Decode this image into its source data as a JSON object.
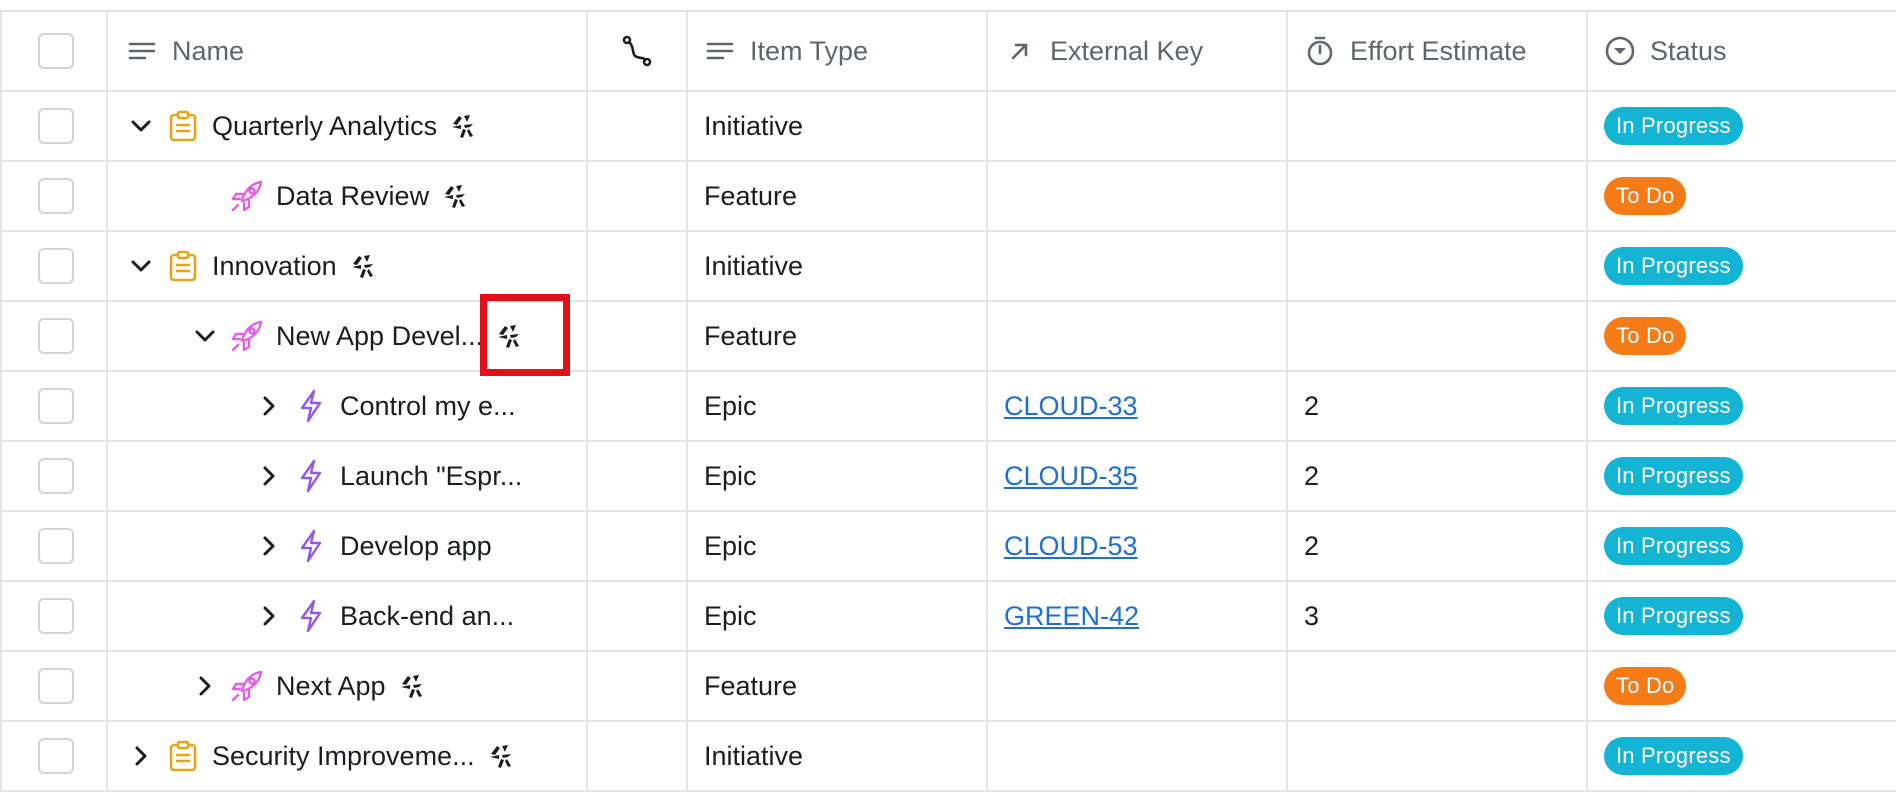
{
  "columns": {
    "name": "Name",
    "item_type": "Item Type",
    "external_key": "External Key",
    "effort": "Effort Estimate",
    "status": "Status"
  },
  "colors": {
    "in_progress": "#13b4d4",
    "to_do": "#f57b16",
    "initiative_icon": "#e8a317",
    "feature_icon": "#e45ee8",
    "epic_icon": "#9458e6",
    "link": "#1f6fd1",
    "highlight": "#e3101a"
  },
  "rows": [
    {
      "name": "Quarterly Analytics",
      "type": "Initiative",
      "key": "",
      "effort": "",
      "status": "In Progress",
      "icon": "clipboard-icon",
      "chevron": "chevron-down-icon"
    },
    {
      "name": "Data Review",
      "type": "Feature",
      "key": "",
      "effort": "",
      "status": "To Do",
      "icon": "rocket-icon",
      "chevron": ""
    },
    {
      "name": "Innovation",
      "type": "Initiative",
      "key": "",
      "effort": "",
      "status": "In Progress",
      "icon": "clipboard-icon",
      "chevron": "chevron-down-icon"
    },
    {
      "name": "New App Devel...",
      "type": "Feature",
      "key": "",
      "effort": "",
      "status": "To Do",
      "icon": "rocket-icon",
      "chevron": "chevron-down-icon"
    },
    {
      "name": "Control my e...",
      "type": "Epic",
      "key": "CLOUD-33",
      "effort": "2",
      "status": "In Progress",
      "icon": "lightning-icon",
      "chevron": "chevron-right-icon"
    },
    {
      "name": "Launch \"Espr...",
      "type": "Epic",
      "key": "CLOUD-35",
      "effort": "2",
      "status": "In Progress",
      "icon": "lightning-icon",
      "chevron": "chevron-right-icon"
    },
    {
      "name": "Develop app",
      "type": "Epic",
      "key": "CLOUD-53",
      "effort": "2",
      "status": "In Progress",
      "icon": "lightning-icon",
      "chevron": "chevron-right-icon"
    },
    {
      "name": "Back-end an...",
      "type": "Epic",
      "key": "GREEN-42",
      "effort": "3",
      "status": "In Progress",
      "icon": "lightning-icon",
      "chevron": "chevron-right-icon"
    },
    {
      "name": "Next App",
      "type": "Feature",
      "key": "",
      "effort": "",
      "status": "To Do",
      "icon": "rocket-icon",
      "chevron": "chevron-right-icon"
    },
    {
      "name": "Security Improveme...",
      "type": "Initiative",
      "key": "",
      "effort": "",
      "status": "In Progress",
      "icon": "clipboard-icon",
      "chevron": "chevron-right-icon"
    }
  ]
}
